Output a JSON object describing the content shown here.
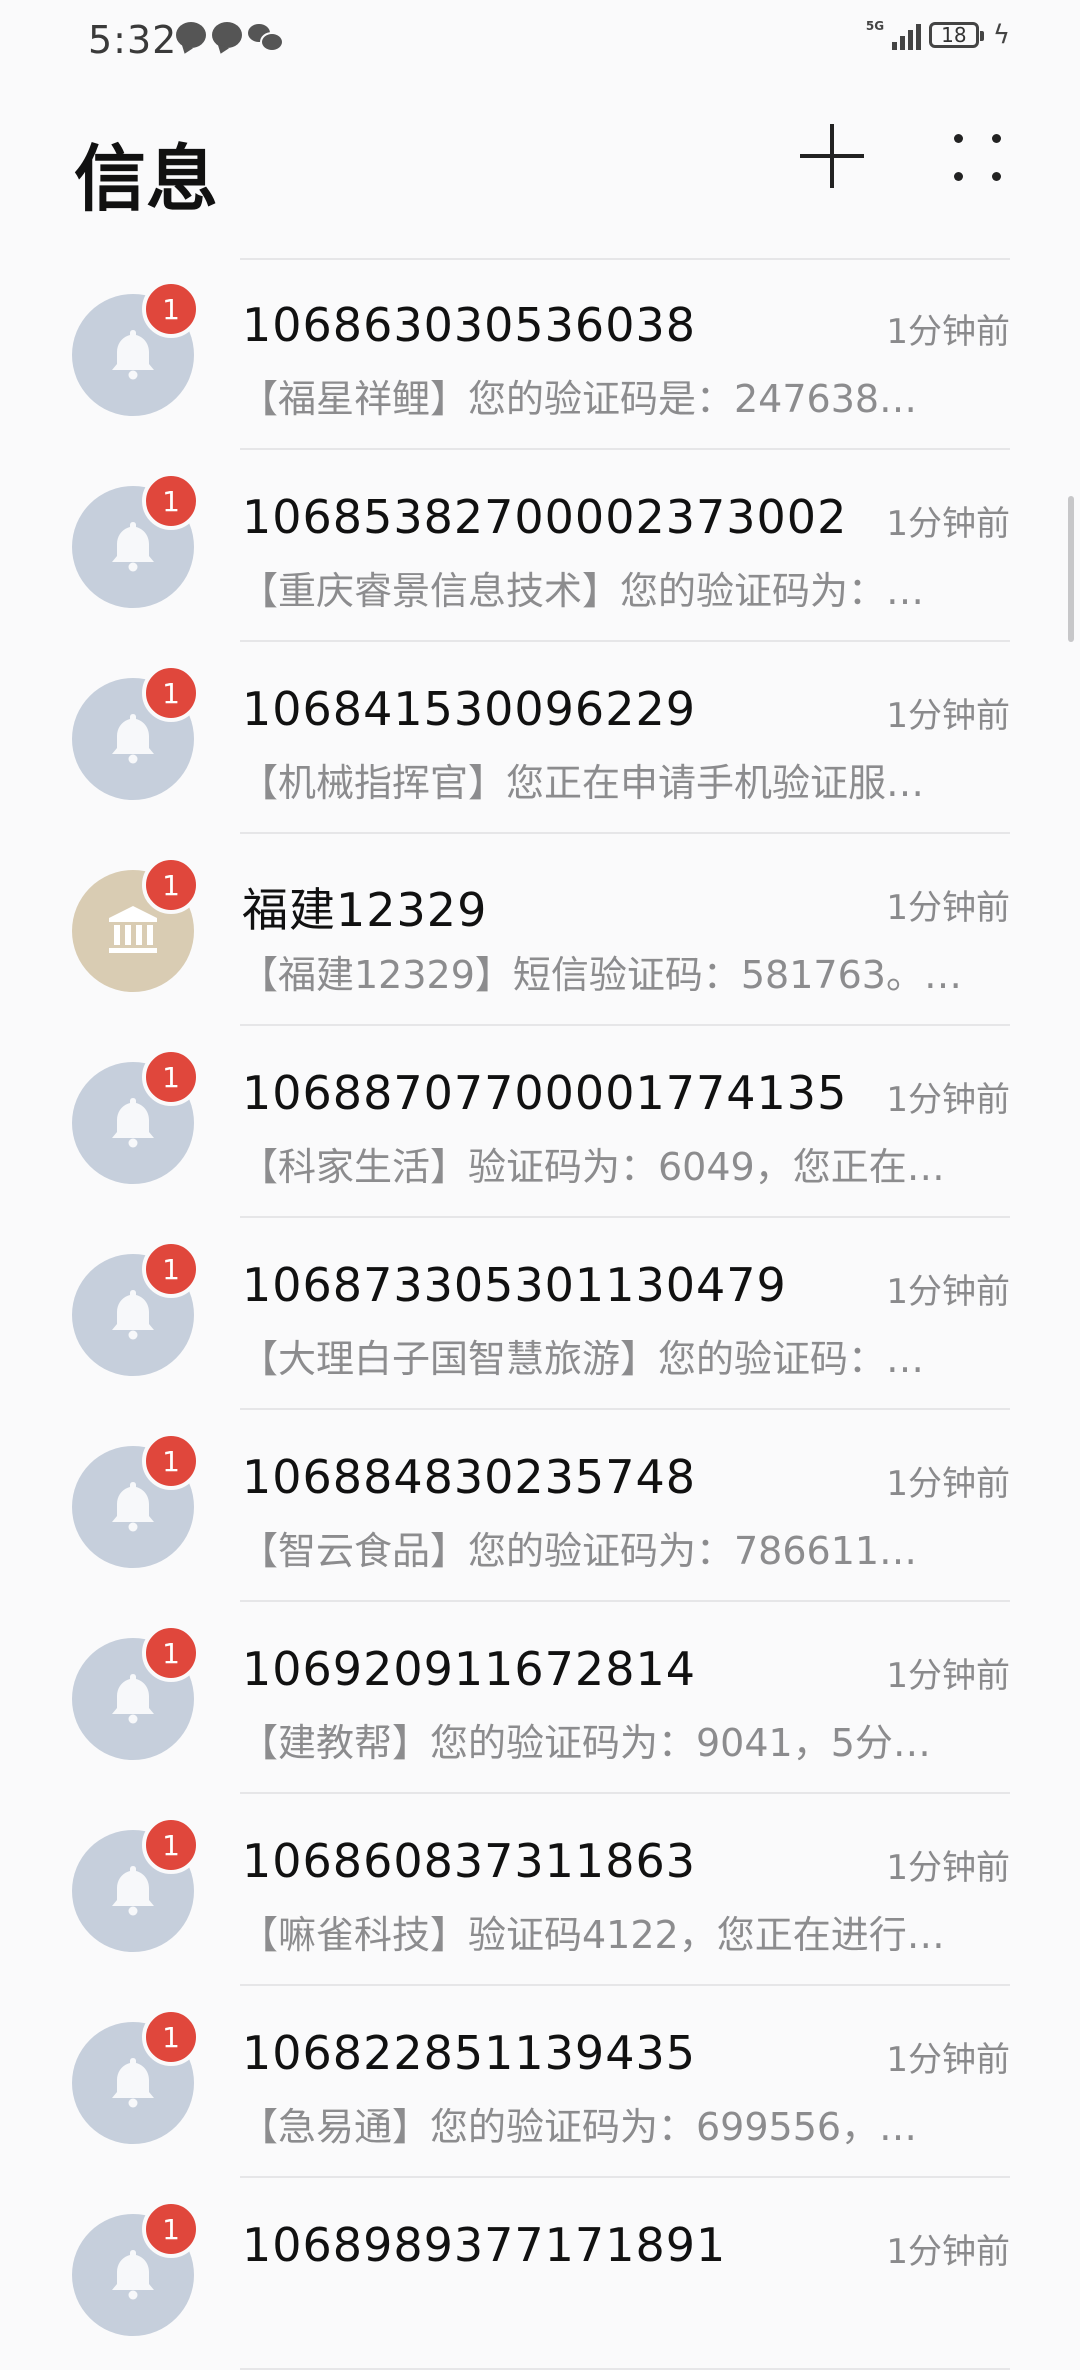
{
  "status": {
    "time": "5:32",
    "network": "5G",
    "battery": "18"
  },
  "header": {
    "title": "信息"
  },
  "messages": [
    {
      "sender": "106863030536038",
      "time": "1分钟前",
      "preview": "【福星祥鲤】您的验证码是：247638…",
      "badge": "1",
      "avatar": "bell-icon"
    },
    {
      "sender": "1068538270000237 3002",
      "time": "1分钟前",
      "preview": "【重庆睿景信息技术】您的验证码为：…",
      "badge": "1",
      "avatar": "bell-icon"
    },
    {
      "sender": "106841530096229",
      "time": "1分钟前",
      "preview": "【机械指挥官】您正在申请手机验证服…",
      "badge": "1",
      "avatar": "bell-icon"
    },
    {
      "sender": "福建12329",
      "time": "1分钟前",
      "preview": "【福建12329】短信验证码：581763。…",
      "badge": "1",
      "avatar": "bank-icon"
    },
    {
      "sender": "1068870770000 1774135",
      "time": "1分钟前",
      "preview": "【科家生活】验证码为：6049，您正在…",
      "badge": "1",
      "avatar": "bell-icon"
    },
    {
      "sender": "106873305301130479",
      "time": "1分钟前",
      "preview": "【大理白子国智慧旅游】您的验证码：…",
      "badge": "1",
      "avatar": "bell-icon"
    },
    {
      "sender": "106884830235748",
      "time": "1分钟前",
      "preview": "【智云食品】您的验证码为：786611…",
      "badge": "1",
      "avatar": "bell-icon"
    },
    {
      "sender": "106920911672814",
      "time": "1分钟前",
      "preview": "【建教帮】您的验证码为：9041，5分…",
      "badge": "1",
      "avatar": "bell-icon"
    },
    {
      "sender": "106860837311863",
      "time": "1分钟前",
      "preview": "【嘛雀科技】验证码4122，您正在进行…",
      "badge": "1",
      "avatar": "bell-icon"
    },
    {
      "sender": "106822851139435",
      "time": "1分钟前",
      "preview": "【急易通】您的验证码为：699556，…",
      "badge": "1",
      "avatar": "bell-icon"
    },
    {
      "sender": "1068989377171891",
      "time": "1分钟前",
      "preview": "",
      "badge": "1",
      "avatar": "bell-icon"
    }
  ]
}
